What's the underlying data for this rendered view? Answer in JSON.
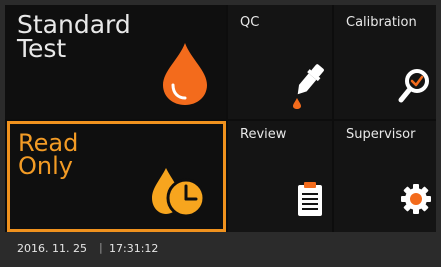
{
  "tiles": {
    "standard_test": {
      "label": "Standard\nTest"
    },
    "qc": {
      "label": "QC"
    },
    "calibration": {
      "label": "Calibration"
    },
    "read_only": {
      "label": "Read\nOnly"
    },
    "review": {
      "label": "Review"
    },
    "supervisor": {
      "label": "Supervisor"
    }
  },
  "status": {
    "date": "2016. 11. 25",
    "separator": "|",
    "time": "17:31:12"
  },
  "colors": {
    "accent_orange": "#f0921e",
    "drop_orange": "#f36b1c",
    "clock_orange": "#f7a51e"
  },
  "icons": {
    "standard_test": "blood-drop-icon",
    "qc": "dropper-icon",
    "calibration": "magnifier-check-icon",
    "read_only": "drop-clock-icon",
    "review": "clipboard-icon",
    "supervisor": "gear-icon"
  }
}
